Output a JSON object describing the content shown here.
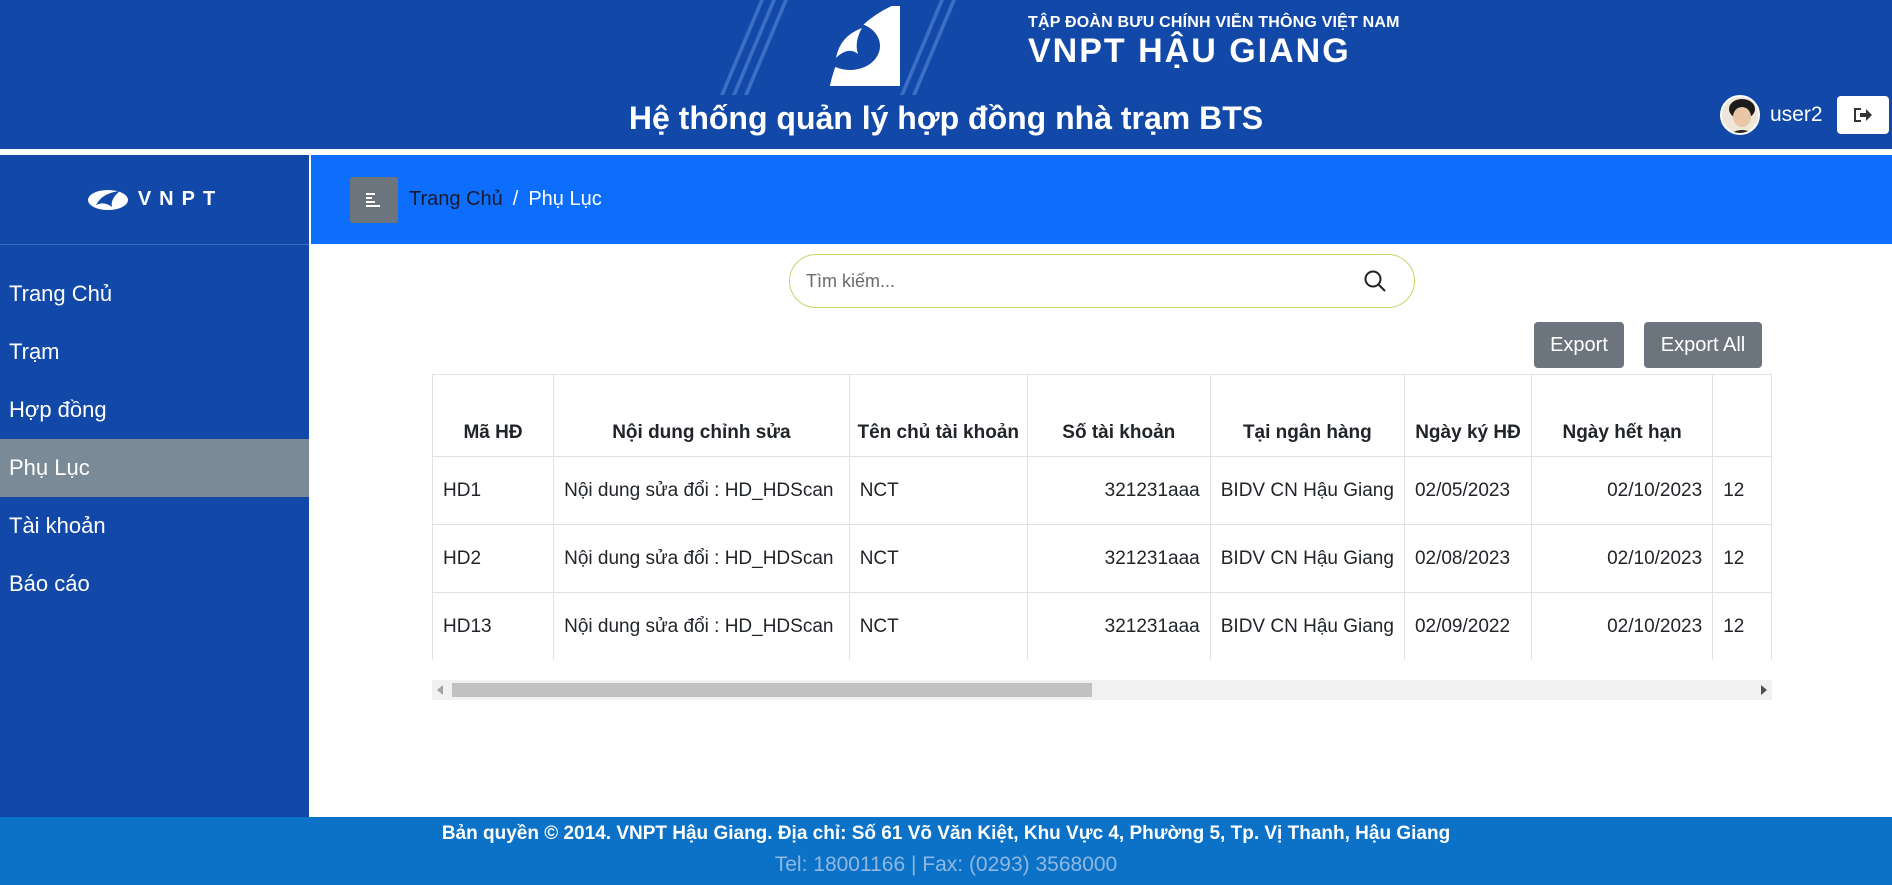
{
  "header": {
    "org_top": "TẬP ĐOÀN BƯU CHÍNH VIỄN THÔNG VIỆT NAM",
    "org_main": "VNPT HẬU GIANG",
    "system_title": "Hệ thống quản lý hợp đồng nhà trạm BTS",
    "user_name": "user2",
    "avatar_icon": "user-avatar",
    "logout_icon": "logout-icon",
    "background_color": "#1249a8"
  },
  "sidebar": {
    "logo_text": "VNPT",
    "items": [
      {
        "label": "Trang Chủ",
        "active": false
      },
      {
        "label": "Trạm",
        "active": false
      },
      {
        "label": "Hợp đồng",
        "active": false
      },
      {
        "label": "Phụ Lục",
        "active": true
      },
      {
        "label": "Tài khoản",
        "active": false
      },
      {
        "label": "Báo cáo",
        "active": false
      }
    ]
  },
  "breadcrumb": {
    "home": "Trang Chủ",
    "separator": "/",
    "current": "Phụ Lục"
  },
  "search": {
    "placeholder": "Tìm kiếm...",
    "value": ""
  },
  "actions": {
    "export_label": "Export",
    "export_all_label": "Export All"
  },
  "table": {
    "columns": [
      "Mã HĐ",
      "Nội dung chỉnh sửa",
      "Tên chủ tài khoản",
      "Số tài khoản",
      "Tại ngân hàng",
      "Ngày ký HĐ",
      "Ngày hết hạn",
      ""
    ],
    "rows": [
      [
        "HD1",
        "Nội dung sửa đổi : HD_HDScan",
        "NCT",
        "321231aaa",
        "BIDV CN Hậu Giang",
        "02/05/2023",
        "02/10/2023",
        "12"
      ],
      [
        "HD2",
        "Nội dung sửa đổi : HD_HDScan",
        "NCT",
        "321231aaa",
        "BIDV CN Hậu Giang",
        "02/08/2023",
        "02/10/2023",
        "12"
      ],
      [
        "HD13",
        "Nội dung sửa đổi : HD_HDScan",
        "NCT",
        "321231aaa",
        "BIDV CN Hậu Giang",
        "02/09/2022",
        "02/10/2023",
        "12"
      ]
    ]
  },
  "footer": {
    "line1": "Bản quyền © 2014. VNPT Hậu Giang. Địa chỉ: Số 61 Võ Văn Kiệt, Khu Vực 4, Phường 5, Tp. Vị Thanh, Hậu Giang",
    "line2": "Tel: 18001166 | Fax: (0293) 3568000"
  }
}
